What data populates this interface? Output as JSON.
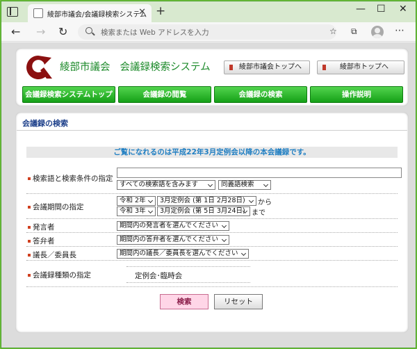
{
  "browser": {
    "tab_title": "綾部市議会/会議録検索システム",
    "tab_close": "✕",
    "new_tab": "+",
    "window_minimize": "—",
    "window_maximize": "☐",
    "window_close": "✕",
    "address_placeholder": "検索または Web アドレスを入力"
  },
  "header": {
    "site_name": "綾部市議会",
    "system_name": "会議録検索システム",
    "top_links": [
      "綾部市議会トップへ",
      "綾部市トップへ"
    ],
    "nav": [
      "会議録検索システムトップ",
      "会議録の閲覧",
      "会議録の検索",
      "操作説明"
    ]
  },
  "search": {
    "title": "会議録の検索",
    "notice": "ご覧になれるのは平成22年3月定例会以降の本会議録です。",
    "rows": {
      "keyword": {
        "label": "検索語と検索条件の指定",
        "value": "",
        "condition": "すべての検索語を含みます",
        "mode": "同義語検索"
      },
      "period": {
        "label": "会議期間の指定",
        "from_year": "令和 2年",
        "from_session": "3月定例会 (第 1日 2月28日)",
        "from_suffix": "から",
        "to_year": "令和 3年",
        "to_session": "3月定例会 (第 5日 3月24日)",
        "to_suffix": "まで"
      },
      "speaker": {
        "label": "発言者",
        "value": "期間内の発言者を選んでください"
      },
      "answerer": {
        "label": "答弁者",
        "value": "期間内の答弁者を選んでください"
      },
      "chair": {
        "label": "議長／委員長",
        "value": "期間内の議長／委員長を選んでください"
      },
      "type": {
        "label": "会議録種類の指定",
        "value": "定例会･臨時会"
      }
    },
    "search_button": "検索",
    "reset_button": "リセット"
  }
}
